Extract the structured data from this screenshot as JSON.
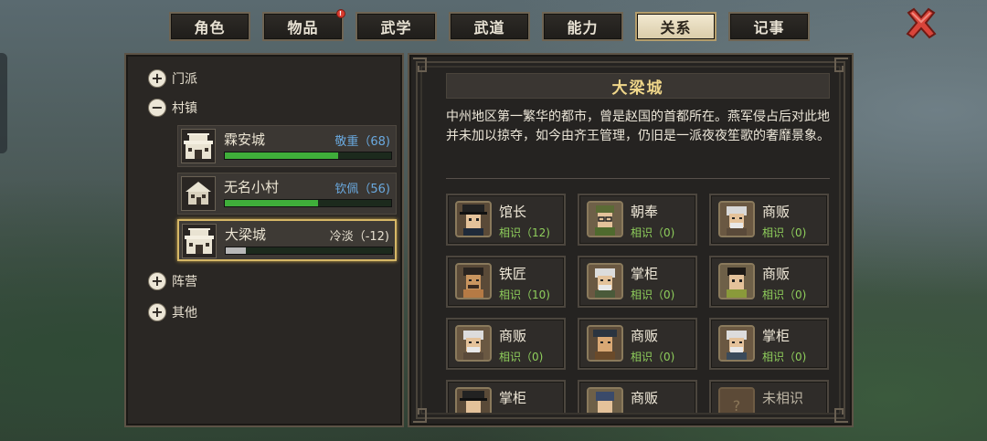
{
  "tabs": [
    {
      "label": "角色",
      "active": false,
      "badge": ""
    },
    {
      "label": "物品",
      "active": false,
      "badge": "!"
    },
    {
      "label": "武学",
      "active": false,
      "badge": ""
    },
    {
      "label": "武道",
      "active": false,
      "badge": ""
    },
    {
      "label": "能力",
      "active": false,
      "badge": ""
    },
    {
      "label": "关系",
      "active": true,
      "badge": ""
    },
    {
      "label": "记事",
      "active": false,
      "badge": ""
    }
  ],
  "categories": {
    "sect": {
      "label": "门派",
      "state": "+"
    },
    "village": {
      "label": "村镇",
      "state": "−"
    },
    "camp": {
      "label": "阵营",
      "state": "+"
    },
    "other": {
      "label": "其他",
      "state": "+"
    }
  },
  "towns": [
    {
      "name": "霖安城",
      "relation": "敬重（68)",
      "level": 0.68,
      "rel_color": "#6aa9df",
      "bar_color": "#3fae3a"
    },
    {
      "name": "无名小村",
      "relation": "钦佩（56)",
      "level": 0.56,
      "rel_color": "#6aa9df",
      "bar_color": "#3fae3a"
    },
    {
      "name": "大梁城",
      "relation": "冷淡（-12)",
      "level": 0.12,
      "rel_color": "#e6dfcf",
      "bar_color": "#b8b8b8"
    }
  ],
  "detail": {
    "title": "大梁城",
    "description": "中州地区第一繁华的都市，曾是赵国的首都所在。燕军侵占后对此地并未加以掠夺，如今由齐王管理，仍旧是一派夜夜笙歌的奢靡景象。"
  },
  "npcs": [
    {
      "name": "馆长",
      "relation": "相识（12)",
      "portrait": "hat-man"
    },
    {
      "name": "朝奉",
      "relation": "相识（0)",
      "portrait": "glasses-man"
    },
    {
      "name": "商贩",
      "relation": "相识（0)",
      "portrait": "old-man"
    },
    {
      "name": "铁匠",
      "relation": "相识（10)",
      "portrait": "smith"
    },
    {
      "name": "掌柜",
      "relation": "相识（0)",
      "portrait": "old-man"
    },
    {
      "name": "商贩",
      "relation": "相识（0)",
      "portrait": "young-man"
    },
    {
      "name": "商贩",
      "relation": "相识（0)",
      "portrait": "old-man"
    },
    {
      "name": "商贩",
      "relation": "相识（0)",
      "portrait": "hat-man"
    },
    {
      "name": "掌柜",
      "relation": "相识（0)",
      "portrait": "old-man"
    },
    {
      "name": "掌柜",
      "relation": "",
      "portrait": "hat-man"
    },
    {
      "name": "商贩",
      "relation": "",
      "portrait": "cap-man"
    },
    {
      "name": "未相识",
      "relation": "",
      "portrait": "unknown"
    }
  ]
}
